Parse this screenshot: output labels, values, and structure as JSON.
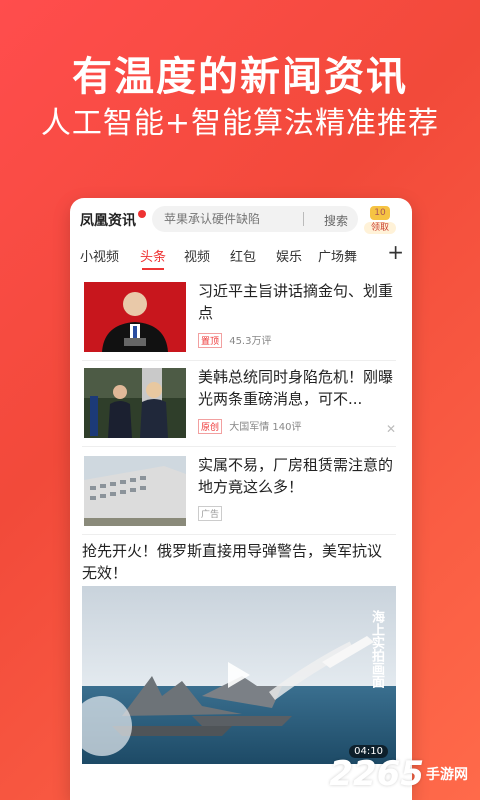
{
  "promo": {
    "headline": "有温度的新闻资讯",
    "subhead": "人工智能+智能算法精准推荐"
  },
  "app": {
    "logo": "凤凰资讯",
    "search_placeholder": "苹果承认硬件缺陷",
    "search_button": "搜索",
    "reward_badge": "领取",
    "reward_coin": "10"
  },
  "tabs": [
    "小视频",
    "头条",
    "视频",
    "红包",
    "娱乐",
    "广场舞"
  ],
  "tabs_active_index": 1,
  "tabs_add": "+",
  "feed": [
    {
      "title": "习近平主旨讲话摘金句、划重点",
      "tag": "置顶",
      "source": "",
      "comments": "45.3万评",
      "thumb": "portrait-photo",
      "show_close": false
    },
    {
      "title": "美韩总统同时身陷危机！刚曝光两条重磅消息，可不...",
      "tag": "原创",
      "source": "大国军情",
      "comments": "140评",
      "thumb": "two-leaders-photo",
      "show_close": true
    },
    {
      "title": "实属不易，厂房租赁需注意的地方竟这么多！",
      "tag": "广告",
      "source": "",
      "comments": "",
      "thumb": "building-photo",
      "show_close": false
    }
  ],
  "big_article": {
    "title": "抢先开火！俄罗斯直接用导弹警告，美军抗议无效！",
    "duration": "04:10",
    "overlay_text": "海上实拍画面"
  },
  "watermark": {
    "brand": "2265",
    "suffix": "手游网"
  }
}
